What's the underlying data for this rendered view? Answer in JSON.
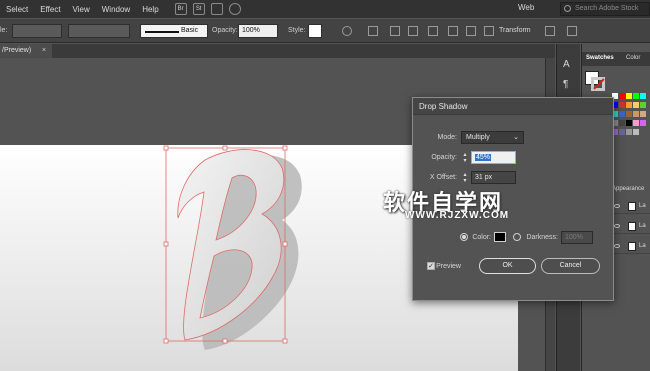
{
  "menubar": {
    "items": [
      "Select",
      "Effect",
      "View",
      "Window",
      "Help"
    ],
    "icon_labels": [
      "Br",
      "St"
    ],
    "workspace": "Web",
    "search_placeholder": "Search Adobe Stock"
  },
  "controlbar": {
    "left_label": "le:",
    "stroke_style": "Basic",
    "opacity_label": "Opacity:",
    "opacity_value": "100%",
    "style_label": "Style:",
    "transform_label": "Transform"
  },
  "document": {
    "tab_label": "/Preview)",
    "close_glyph": "×"
  },
  "panel": {
    "tabs": [
      "Swatches",
      "Color"
    ],
    "appearance_label": "Appearance",
    "layers": [
      {
        "name": "La"
      },
      {
        "name": "La"
      },
      {
        "name": "La"
      }
    ],
    "swatch_colors": [
      "#ffffff",
      "#ff0000",
      "#ffff00",
      "#00ff00",
      "#00ffff",
      "#0000ff",
      "#cc3333",
      "#ff9933",
      "#ffcc66",
      "#66cc33",
      "#33cccc",
      "#3366cc",
      "#996633",
      "#cc9966",
      "#ccaa88",
      "#888888",
      "#444444",
      "#000000",
      "#ff99cc",
      "#cc66ff",
      "#9966cc",
      "#666699",
      "#999999",
      "#bbbbbb"
    ]
  },
  "dialog": {
    "title": "Drop Shadow",
    "mode_label": "Mode:",
    "mode_value": "Multiply",
    "opacity_label": "Opacity:",
    "opacity_value": "45%",
    "x_offset_label": "X Offset:",
    "x_offset_value": "31 px",
    "color_label": "Color:",
    "darkness_label": "Darkness:",
    "darkness_value": "100%",
    "preview_label": "Preview",
    "ok_label": "OK",
    "cancel_label": "Cancel"
  },
  "watermark": {
    "chinese": "软件自学网",
    "url": "WWW.RJZXW.COM"
  },
  "colors": {
    "accent_red": "#d0211b",
    "selection_blue": "#2f73cc",
    "selection_box": "#e06a6a"
  }
}
